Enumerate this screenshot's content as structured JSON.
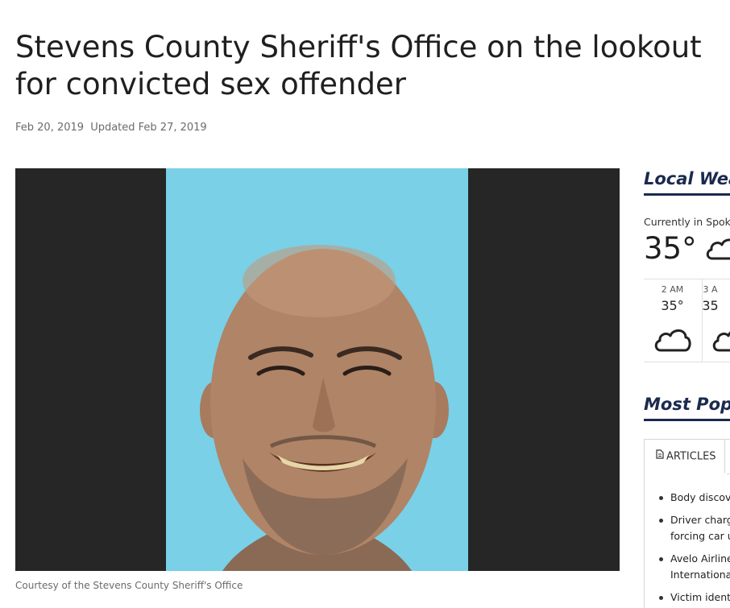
{
  "article": {
    "headline": "Stevens County Sheriff's Office on the lookout for convicted sex offender",
    "published": "Feb 20, 2019",
    "updated": "Updated Feb 27, 2019",
    "caption": "Courtesy of the Stevens County Sheriff's Office"
  },
  "weather": {
    "title": "Local Wea",
    "currently_label": "Currently in Spoka",
    "current_temp": "35°",
    "current_icon": "cloud-icon",
    "hourly": [
      {
        "time": "2 AM",
        "temp": "35°",
        "icon": "cloud-icon"
      },
      {
        "time": "3 A",
        "temp": "35",
        "icon": "cloud-icon"
      }
    ]
  },
  "popular": {
    "title": "Most Popu",
    "tab_label": "ARTICLES",
    "tab_icon": "document-icon",
    "items": [
      "Body discove",
      "Driver charge\nforcing car u",
      "Avelo Airline\nInternational",
      "Victim identi"
    ]
  },
  "colors": {
    "accent": "#1b2a4e",
    "photo_background": "#79d0e7",
    "photo_frame": "#262626"
  }
}
